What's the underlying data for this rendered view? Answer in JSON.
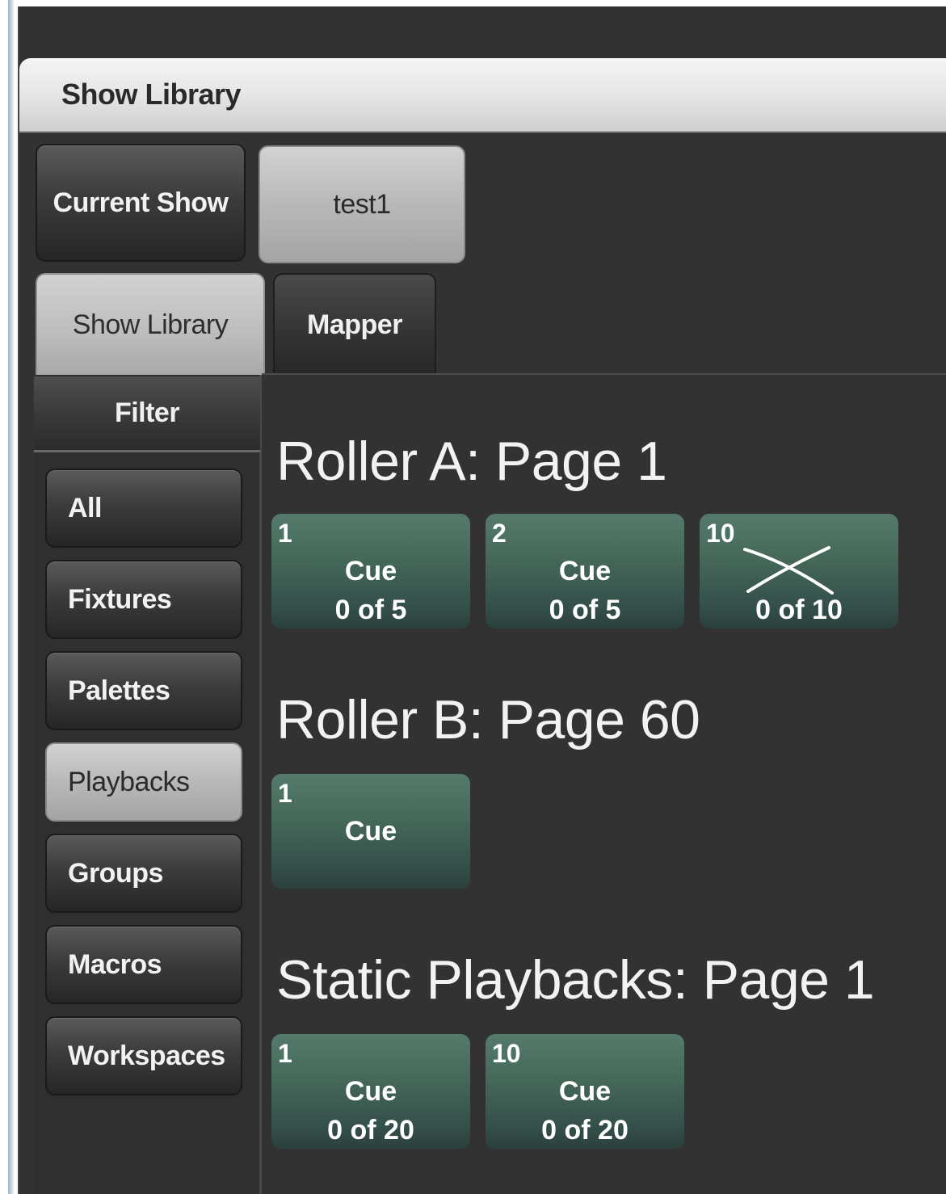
{
  "window": {
    "title": "Show Library"
  },
  "header": {
    "current_show_label": "Current Show",
    "show_name": "test1"
  },
  "tabs": [
    {
      "label": "Show Library",
      "active": true
    },
    {
      "label": "Mapper",
      "active": false
    }
  ],
  "filter": {
    "header": "Filter",
    "items": [
      {
        "label": "All",
        "selected": false
      },
      {
        "label": "Fixtures",
        "selected": false
      },
      {
        "label": "Palettes",
        "selected": false
      },
      {
        "label": "Playbacks",
        "selected": true
      },
      {
        "label": "Groups",
        "selected": false
      },
      {
        "label": "Macros",
        "selected": false
      },
      {
        "label": "Workspaces",
        "selected": false
      }
    ]
  },
  "sections": [
    {
      "title": "Roller A: Page 1",
      "tiles": [
        {
          "number": "1",
          "name": "Cue",
          "count": "0 of 5"
        },
        {
          "number": "2",
          "name": "Cue",
          "count": "0 of 5"
        },
        {
          "number": "10",
          "name": "",
          "count": "0 of 10",
          "icon": "crossed-out-icon"
        }
      ]
    },
    {
      "title": "Roller B: Page 60",
      "tiles": [
        {
          "number": "1",
          "name": "Cue",
          "count": ""
        }
      ]
    },
    {
      "title": "Static Playbacks: Page 1",
      "tiles": [
        {
          "number": "1",
          "name": "Cue",
          "count": "0 of 20"
        },
        {
          "number": "10",
          "name": "Cue",
          "count": "0 of 20"
        }
      ]
    }
  ],
  "colors": {
    "window_bg": "#323232",
    "tile_green": "#456859",
    "selected_button": "#bcbcbc"
  }
}
